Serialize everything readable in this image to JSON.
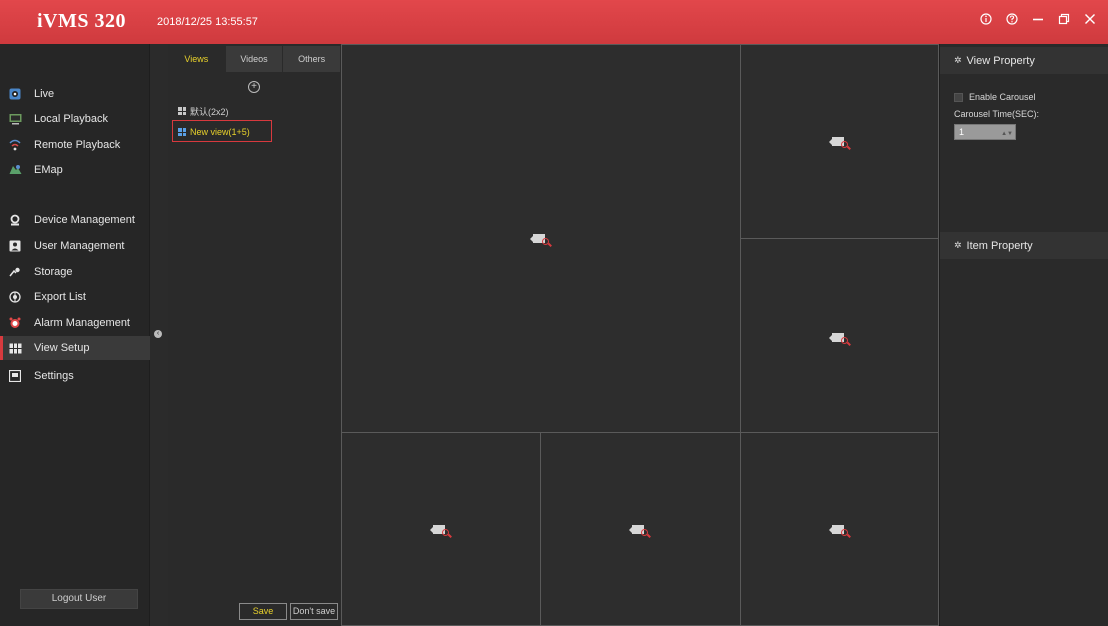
{
  "app": {
    "title": "iVMS 320",
    "datetime": "2018/12/25 13:55:57",
    "brand_color": "#d83a3e",
    "window_controls": [
      {
        "name": "info-icon",
        "glyph": "⓪"
      },
      {
        "name": "help-icon",
        "glyph": "⊙"
      },
      {
        "name": "minimize-icon",
        "glyph": "—"
      },
      {
        "name": "restore-icon",
        "glyph": "❐"
      },
      {
        "name": "close-icon",
        "glyph": "✕"
      }
    ]
  },
  "sidebar": {
    "items": [
      {
        "label": "Live",
        "icon": "live-icon"
      },
      {
        "label": "Local Playback",
        "icon": "local-playback-icon"
      },
      {
        "label": "Remote Playback",
        "icon": "remote-playback-icon"
      },
      {
        "label": "EMap",
        "icon": "emap-icon"
      },
      {
        "label": "Device Management",
        "icon": "device-management-icon"
      },
      {
        "label": "User Management",
        "icon": "user-management-icon"
      },
      {
        "label": "Storage",
        "icon": "storage-icon"
      },
      {
        "label": "Export List",
        "icon": "export-list-icon"
      },
      {
        "label": "Alarm Management",
        "icon": "alarm-icon"
      },
      {
        "label": "View Setup",
        "icon": "view-setup-icon",
        "active": true
      },
      {
        "label": "Settings",
        "icon": "settings-icon"
      }
    ],
    "logout_label": "Logout User"
  },
  "views_panel": {
    "tabs": [
      {
        "label": "Views",
        "active": true
      },
      {
        "label": "Videos"
      },
      {
        "label": "Others"
      }
    ],
    "views": [
      {
        "label": "默认(2x2)"
      },
      {
        "label": "New view(1+5)",
        "selected": true
      }
    ],
    "save_label": "Save",
    "dont_save_label": "Don't save"
  },
  "right_panel": {
    "view_property_title": "View Property",
    "enable_carousel_label": "Enable Carousel",
    "carousel_time_label": "Carousel Time(SEC):",
    "carousel_time_value": "1",
    "item_property_title": "Item Property"
  }
}
